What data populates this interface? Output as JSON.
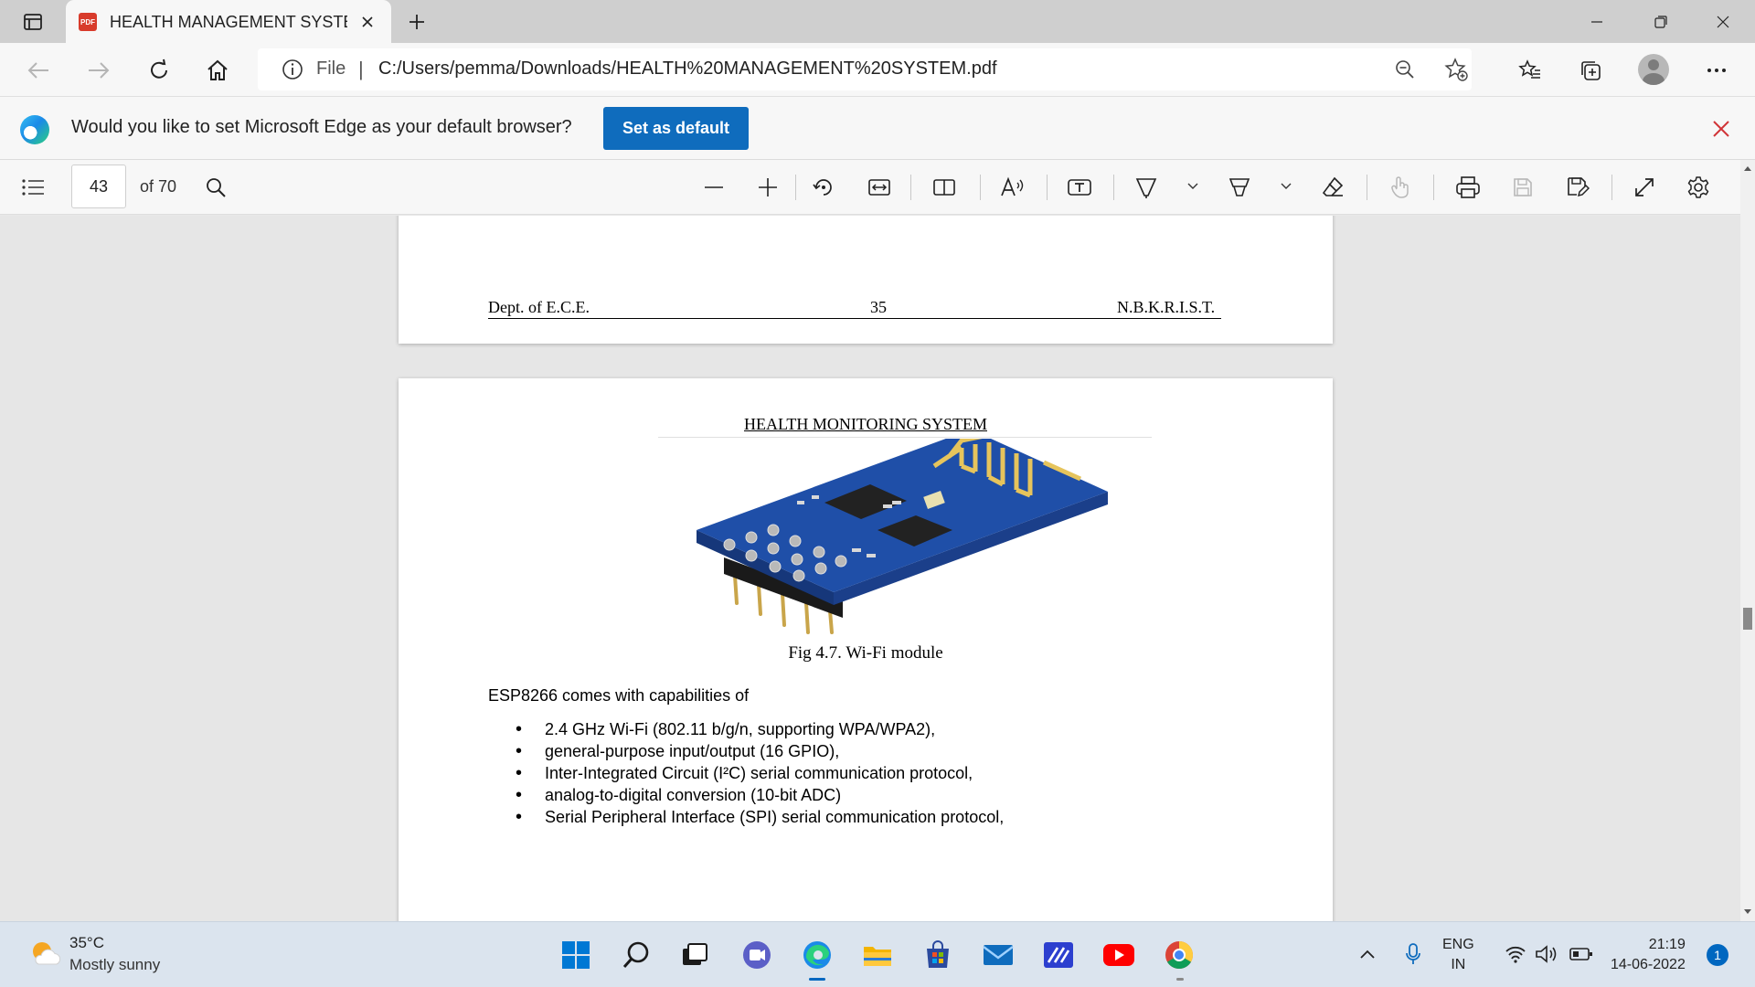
{
  "tab": {
    "title": "HEALTH MANAGEMENT SYSTEM",
    "badge": "PDF"
  },
  "address": {
    "scheme_label": "File",
    "url": "C:/Users/pemma/Downloads/HEALTH%20MANAGEMENT%20SYSTEM.pdf"
  },
  "infobar": {
    "message": "Would you like to set Microsoft Edge as your default browser?",
    "button_label": "Set as default"
  },
  "pdf_toolbar": {
    "page_number": "43",
    "page_total": "of 70"
  },
  "document": {
    "footer": {
      "left": "Dept. of E.C.E.",
      "center": "35",
      "right": "N.B.K.R.I.S.T."
    },
    "header": "HEALTH MONITORING SYSTEM",
    "figure_caption": "Fig 4.7. Wi-Fi module",
    "intro": "ESP8266 comes with capabilities of",
    "bullets": [
      "2.4 GHz Wi-Fi (802.11 b/g/n, supporting WPA/WPA2),",
      "general-purpose input/output (16 GPIO),",
      "Inter-Integrated Circuit (I²C) serial communication protocol,",
      "analog-to-digital conversion (10-bit ADC)",
      "Serial Peripheral Interface (SPI) serial communication protocol,"
    ]
  },
  "taskbar": {
    "weather": {
      "temperature": "35°C",
      "condition": "Mostly sunny"
    },
    "language": {
      "line1": "ENG",
      "line2": "IN"
    },
    "clock": {
      "time": "21:19",
      "date": "14-06-2022"
    },
    "notification_count": "1"
  },
  "colors": {
    "accent": "#0f6cbd",
    "close_red": "#d13438",
    "pcb_blue": "#1f4fa8",
    "antenna_gold": "#e6c45c"
  }
}
